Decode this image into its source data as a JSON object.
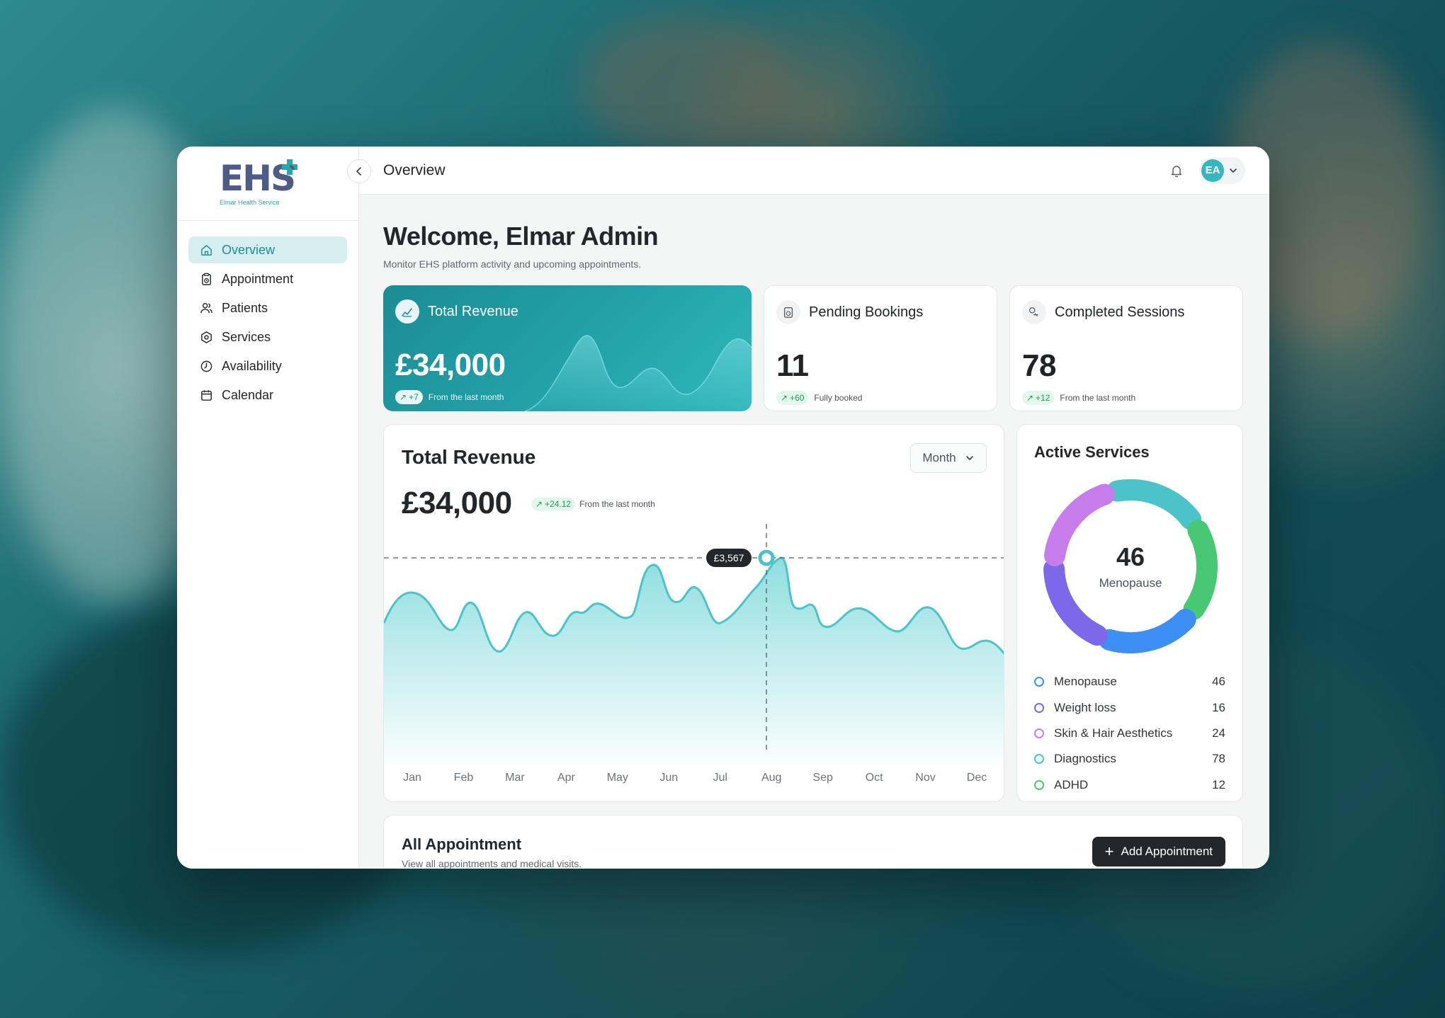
{
  "brand": {
    "logo_text": "EHS",
    "logo_subtitle": "Elmar Health Service"
  },
  "sidebar": {
    "items": [
      {
        "label": "Overview",
        "icon": "home-icon",
        "active": true
      },
      {
        "label": "Appointment",
        "icon": "clipboard-icon",
        "active": false
      },
      {
        "label": "Patients",
        "icon": "users-icon",
        "active": false
      },
      {
        "label": "Services",
        "icon": "hexagon-icon",
        "active": false
      },
      {
        "label": "Availability",
        "icon": "clock-icon",
        "active": false
      },
      {
        "label": "Calendar",
        "icon": "calendar-icon",
        "active": false
      }
    ]
  },
  "header": {
    "title": "Overview",
    "avatar_initials": "EA"
  },
  "welcome": {
    "title": "Welcome, Elmar Admin",
    "subtitle": "Monitor EHS platform activity and upcoming appointments."
  },
  "stats": [
    {
      "title": "Total Revenue",
      "value": "£34,000",
      "badge": "+7",
      "note": "From the last month"
    },
    {
      "title": "Pending Bookings",
      "value": "11",
      "badge": "+60",
      "note": "Fully booked"
    },
    {
      "title": "Completed Sessions",
      "value": "78",
      "badge": "+12",
      "note": "From the last month"
    }
  ],
  "revenue": {
    "title": "Total Revenue",
    "value": "£34,000",
    "badge": "+24.12",
    "note": "From the last month",
    "period": "Month",
    "tooltip": "£3,567"
  },
  "chart_data": {
    "type": "area",
    "x": [
      "Jan",
      "Feb",
      "Mar",
      "Apr",
      "May",
      "Jun",
      "Jul",
      "Aug",
      "Sep",
      "Oct",
      "Nov",
      "Dec"
    ],
    "highlight": {
      "x": "Aug",
      "label": "£3,567"
    },
    "color": "#4cc3c8"
  },
  "services": {
    "title": "Active Services",
    "center_value": "46",
    "center_label": "Menopause",
    "items": [
      {
        "name": "Menopause",
        "value": "46",
        "color": "#3d8ef5"
      },
      {
        "name": "Weight loss",
        "value": "16",
        "color": "#7d68ea"
      },
      {
        "name": "Skin & Hair Aesthetics",
        "value": "24",
        "color": "#c77cec"
      },
      {
        "name": "Diagnostics",
        "value": "78",
        "color": "#4cc3c8"
      },
      {
        "name": "ADHD",
        "value": "12",
        "color": "#48c774"
      }
    ]
  },
  "appointments": {
    "title": "All Appointment",
    "subtitle": "View all appointments and medical visits.",
    "add_label": "Add Appointment"
  }
}
